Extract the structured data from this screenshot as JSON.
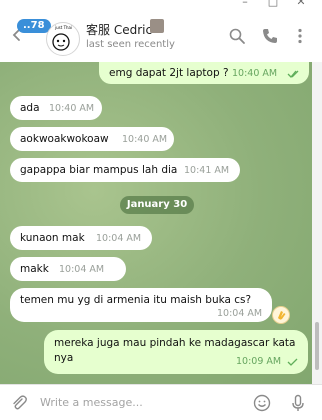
{
  "header": {
    "unread_badge": "78",
    "contact_name": "客服 Cedric",
    "status": "last seen recently",
    "avatar_text": "just Thai"
  },
  "chat": {
    "date_separator": "January 30",
    "messages": [
      {
        "direction": "out",
        "text": "emg dapat 2jt laptop ?",
        "time": "10:40 AM",
        "read": true
      },
      {
        "direction": "in",
        "text": "ada",
        "time": "10:40 AM"
      },
      {
        "direction": "in",
        "text": "aokwoakwokoaw",
        "time": "10:40 AM"
      },
      {
        "direction": "in",
        "text": "gapappa biar mampus lah dia",
        "time": "10:41 AM"
      },
      {
        "direction": "in",
        "text": "kunaon mak",
        "time": "10:04 AM"
      },
      {
        "direction": "in",
        "text": "makk",
        "time": "10:04 AM"
      },
      {
        "direction": "in",
        "text": "temen mu yg di armenia itu maish buka cs?",
        "time": "10:04 AM",
        "reaction": "clap-emoji"
      },
      {
        "direction": "out",
        "text_line1": "mereka juga mau pindah ke madagascar kata",
        "text_line2": "nya",
        "time": "10:09 AM",
        "read": false
      }
    ]
  },
  "composer": {
    "placeholder": "Write a message..."
  },
  "icons": [
    "back-arrow-icon",
    "search-icon",
    "phone-icon",
    "more-icon",
    "paperclip-icon",
    "emoji-icon",
    "microphone-icon",
    "double-check-icon",
    "single-check-icon"
  ],
  "colors": {
    "accent": "#3a8fd9",
    "outgoing_bubble": "#e6ffcf",
    "incoming_bubble": "#ffffff",
    "chat_background": "#8fb07a",
    "outgoing_time": "#67a660"
  }
}
